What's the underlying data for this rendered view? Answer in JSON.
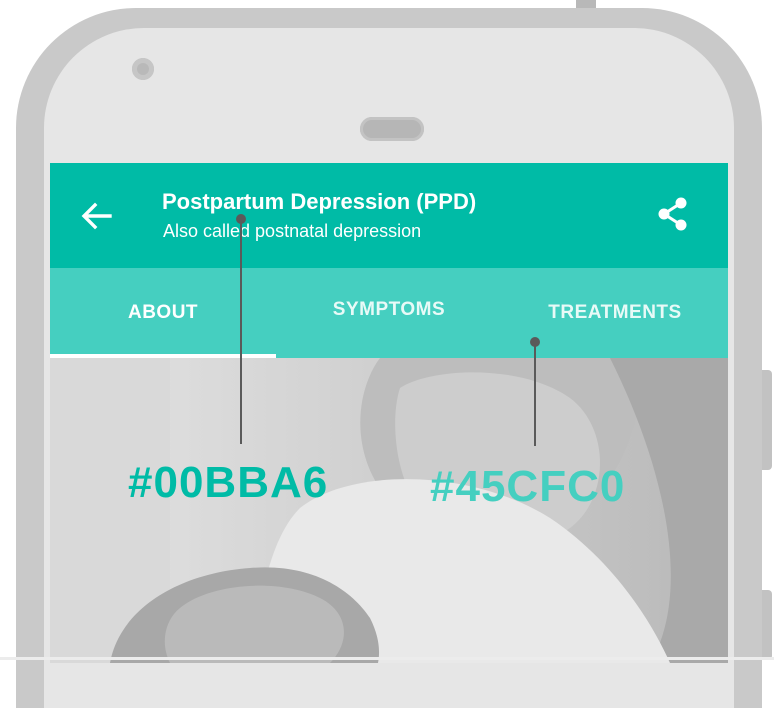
{
  "app_bar": {
    "title": "Postpartum Depression (PPD)",
    "subtitle": "Also called postnatal depression",
    "back_icon": "arrow-back-icon",
    "share_icon": "share-icon",
    "color": "#00BBA6"
  },
  "tabs": {
    "color": "#45CFC0",
    "items": [
      {
        "label": "ABOUT",
        "selected": true
      },
      {
        "label": "SYMPTOMS",
        "selected": false
      },
      {
        "label": "TREATMENTS",
        "selected": false
      }
    ]
  },
  "annotations": {
    "primary": {
      "label": "#00BBA6",
      "color": "#00BBA6"
    },
    "secondary": {
      "label": "#45CFC0",
      "color": "#45CFC0"
    }
  }
}
